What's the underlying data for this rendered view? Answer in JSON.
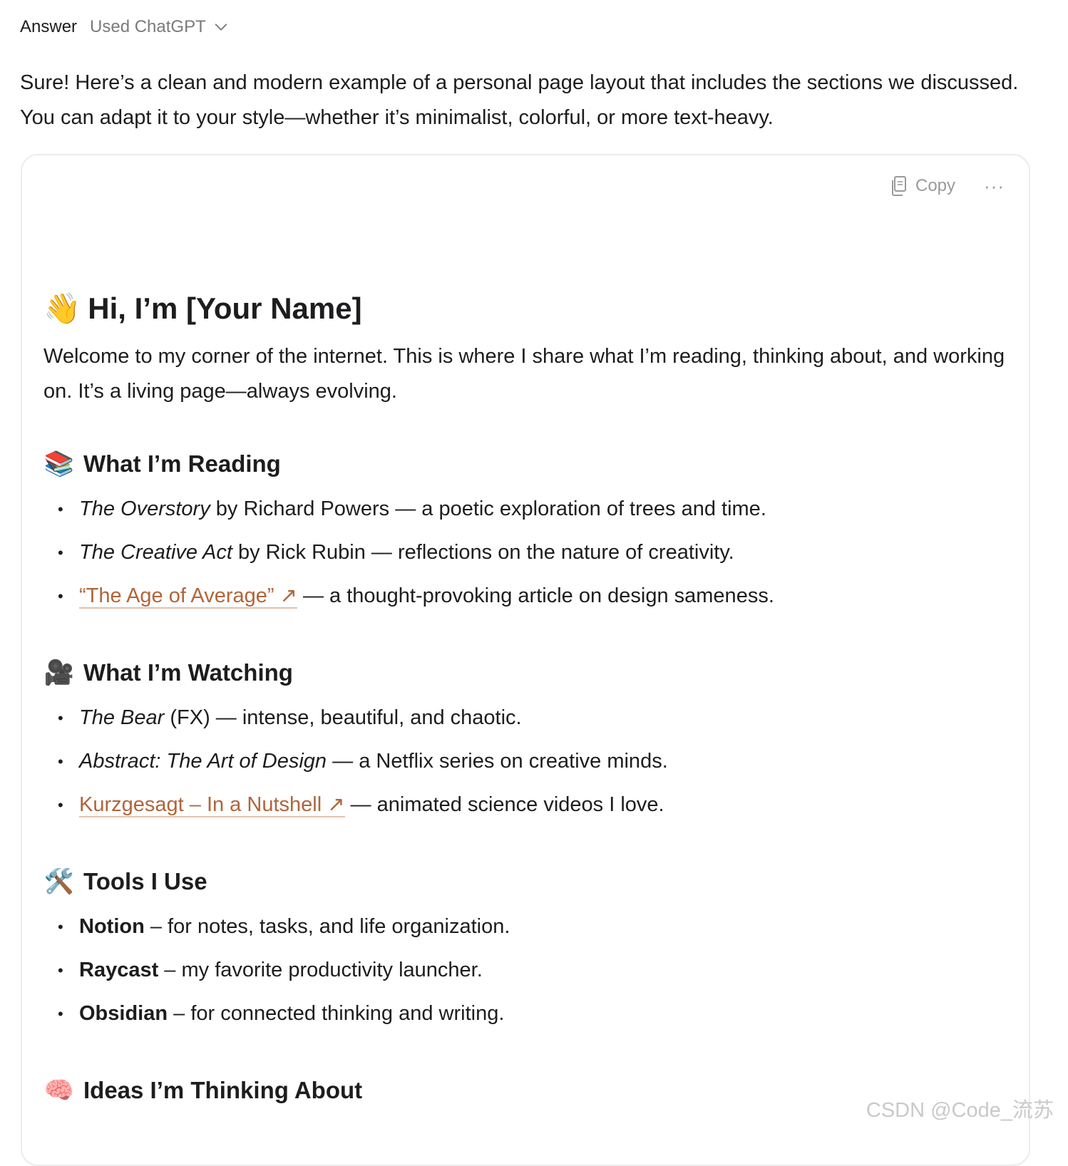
{
  "header": {
    "answer_label": "Answer",
    "model_label": "Used ChatGPT",
    "chevron_icon": "chevron-down-icon"
  },
  "intro": "Sure! Here’s a clean and modern example of a personal page layout that includes the sections we discussed. You can adapt it to your style—whether it’s minimalist, colorful, or more text-heavy.",
  "card": {
    "copy_label": "Copy",
    "copy_icon": "copy-icon",
    "more_label": "···"
  },
  "page": {
    "title_emoji": "👋",
    "title": "Hi, I’m [Your Name]",
    "welcome": "Welcome to my corner of the internet. This is where I share what I’m reading, thinking about, and working on. It’s a living page—always evolving.",
    "reading": {
      "emoji": "📚",
      "heading": "What I’m Reading",
      "items": [
        {
          "title": "The Overstory",
          "rest": " by Richard Powers — a poetic exploration of trees and time."
        },
        {
          "title": "The Creative Act",
          "rest": " by Rick Rubin — reflections on the nature of creativity."
        },
        {
          "link": "“The Age of Average” ↗",
          "rest": " — a thought-provoking article on design sameness."
        }
      ]
    },
    "watching": {
      "emoji": "🎥",
      "heading": "What I’m Watching",
      "items": [
        {
          "title": "The Bear",
          "rest": " (FX) — intense, beautiful, and chaotic."
        },
        {
          "title": "Abstract: The Art of Design",
          "rest": " — a Netflix series on creative minds."
        },
        {
          "link": "Kurzgesagt – In a Nutshell ↗",
          "rest": " — animated science videos I love."
        }
      ]
    },
    "tools": {
      "emoji": "🛠️",
      "heading": "Tools I Use",
      "items": [
        {
          "name": "Notion",
          "rest": " – for notes, tasks, and life organization."
        },
        {
          "name": "Raycast",
          "rest": " – my favorite productivity launcher."
        },
        {
          "name": "Obsidian",
          "rest": " – for connected thinking and writing."
        }
      ]
    },
    "ideas": {
      "emoji": "🧠",
      "heading": "Ideas I’m Thinking About"
    }
  },
  "bullet": "•",
  "watermark": "CSDN @Code_流苏",
  "colors": {
    "link": "#b0653a",
    "muted": "#7a7a7a",
    "text": "#1d1d1f"
  }
}
